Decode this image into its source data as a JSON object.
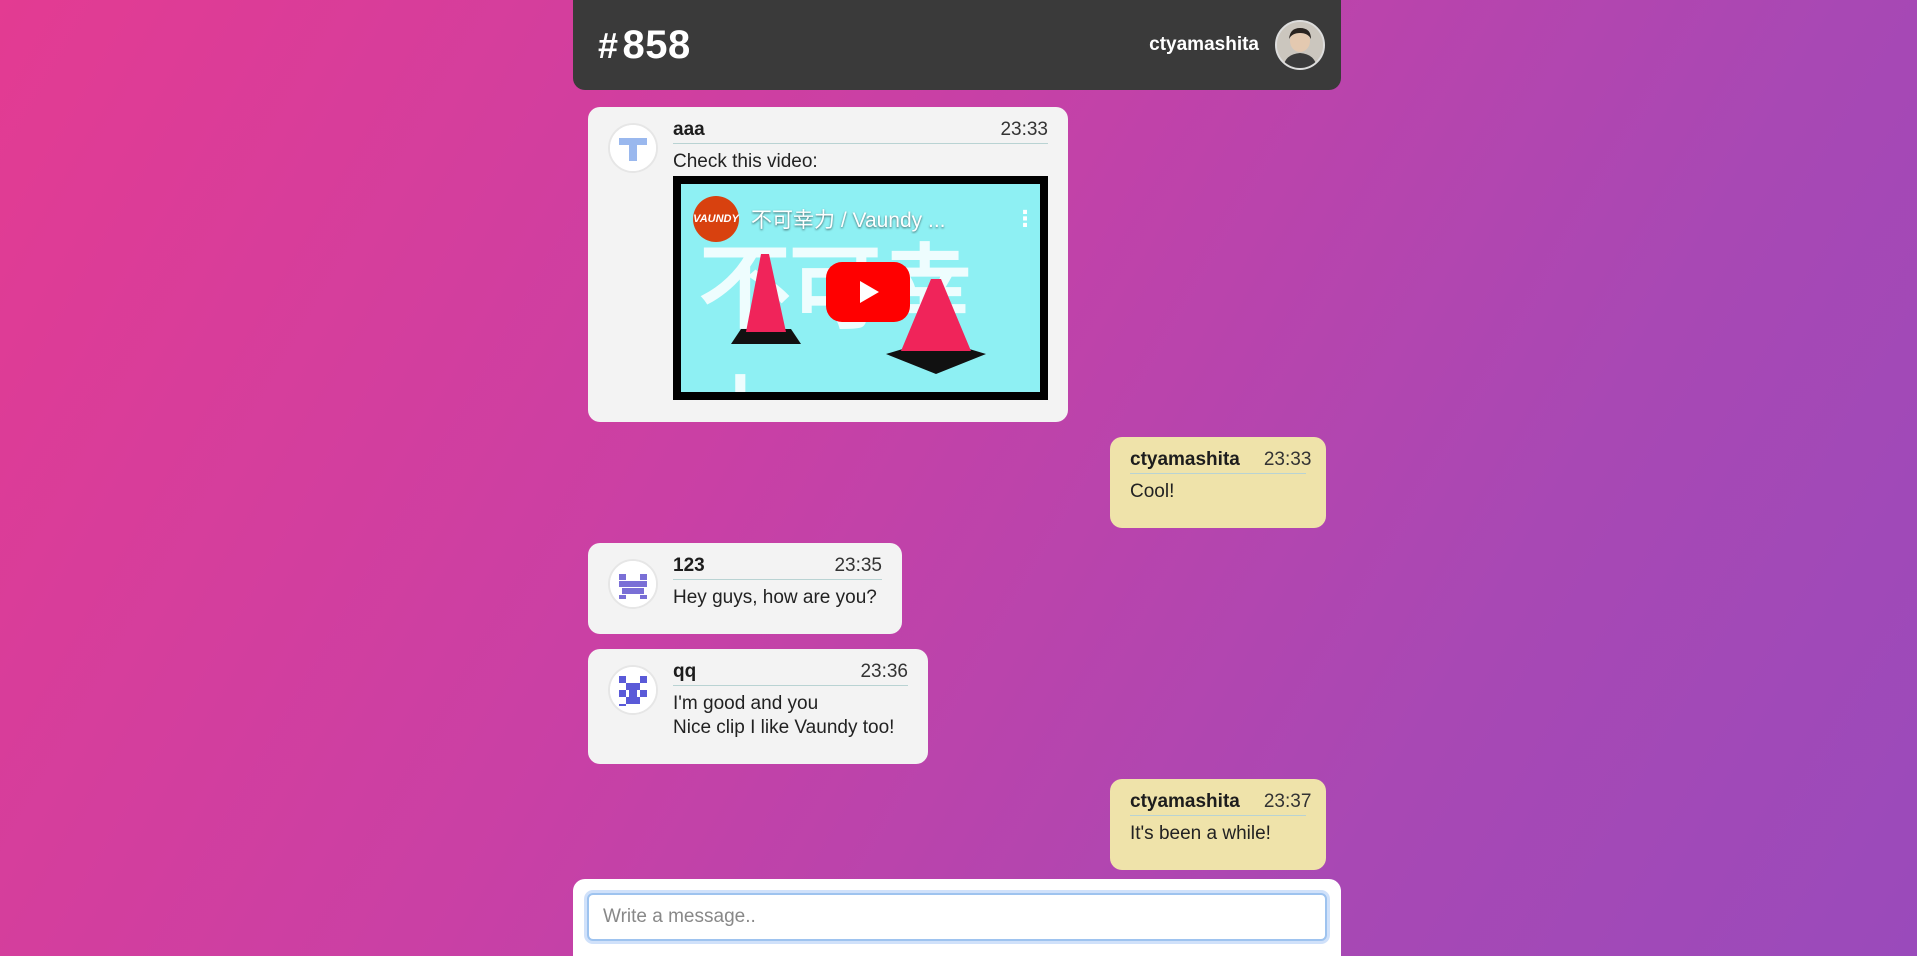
{
  "header": {
    "room_hash": "#",
    "room_number": "858",
    "username": "ctyamashita"
  },
  "messages": [
    {
      "name": "aaa",
      "time": "23:33",
      "text": "Check this video:",
      "video": {
        "channel": "VAUNDY",
        "title": "不可幸力 / Vaundy ...",
        "thumbnail_text": "不可幸力"
      }
    },
    {
      "name": "ctyamashita",
      "time": "23:33",
      "text": "Cool!"
    },
    {
      "name": "123",
      "time": "23:35",
      "text": "Hey guys, how are you?"
    },
    {
      "name": "qq",
      "time": "23:36",
      "text": "I'm good and you\nNice clip I like Vaundy too!"
    },
    {
      "name": "ctyamashita",
      "time": "23:37",
      "text": "It's been a while!"
    }
  ],
  "composer": {
    "placeholder": "Write a message.."
  },
  "colors": {
    "bg_gradient_start": "#e33b92",
    "bg_gradient_end": "#9a4abb",
    "header_bg": "#3a3a3a",
    "own_message_bg": "#efe3aa",
    "other_message_bg": "#f3f3f3",
    "identicon_blue": "#9ab8ee",
    "identicon_purple": "#7a6fd6",
    "identicon_indigo": "#5a5ad8"
  }
}
